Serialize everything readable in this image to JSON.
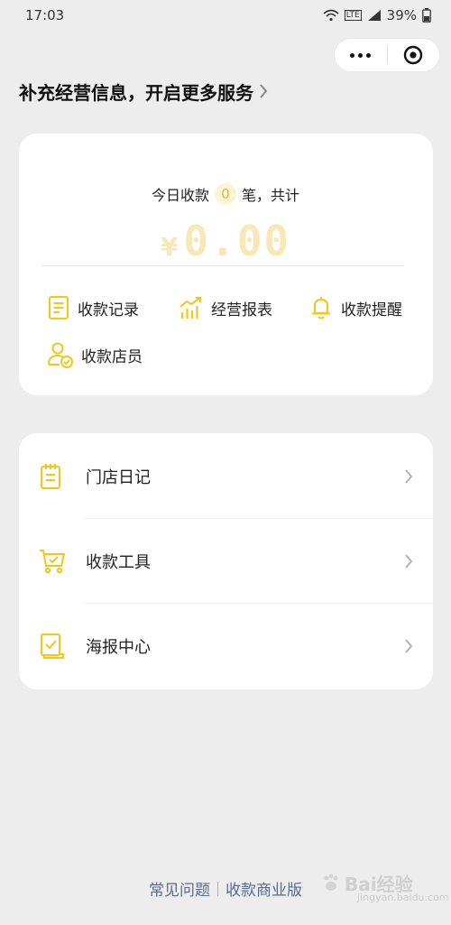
{
  "status_bar": {
    "time": "17:03",
    "network": "LTE",
    "battery": "39%"
  },
  "banner": {
    "title": "补充经营信息，开启更多服务"
  },
  "stats": {
    "prefix": "今日收款",
    "count": "0",
    "suffix": "笔，共计",
    "currency": "¥",
    "amount": "0.00"
  },
  "actions": [
    {
      "label": "收款记录",
      "icon": "document-icon"
    },
    {
      "label": "经营报表",
      "icon": "bar-chart-icon"
    },
    {
      "label": "收款提醒",
      "icon": "bell-icon"
    },
    {
      "label": "收款店员",
      "icon": "staff-icon"
    }
  ],
  "menu": [
    {
      "label": "门店日记",
      "icon": "notebook-icon"
    },
    {
      "label": "收款工具",
      "icon": "cart-icon"
    },
    {
      "label": "海报中心",
      "icon": "poster-icon"
    }
  ],
  "footer": {
    "faq": "常见问题",
    "business": "收款商业版"
  },
  "watermark": {
    "text": "Bai经验",
    "sub": "jingyan.baidu.com"
  },
  "colors": {
    "accent": "#f5c518",
    "link": "#576b95",
    "background": "#ededed"
  }
}
